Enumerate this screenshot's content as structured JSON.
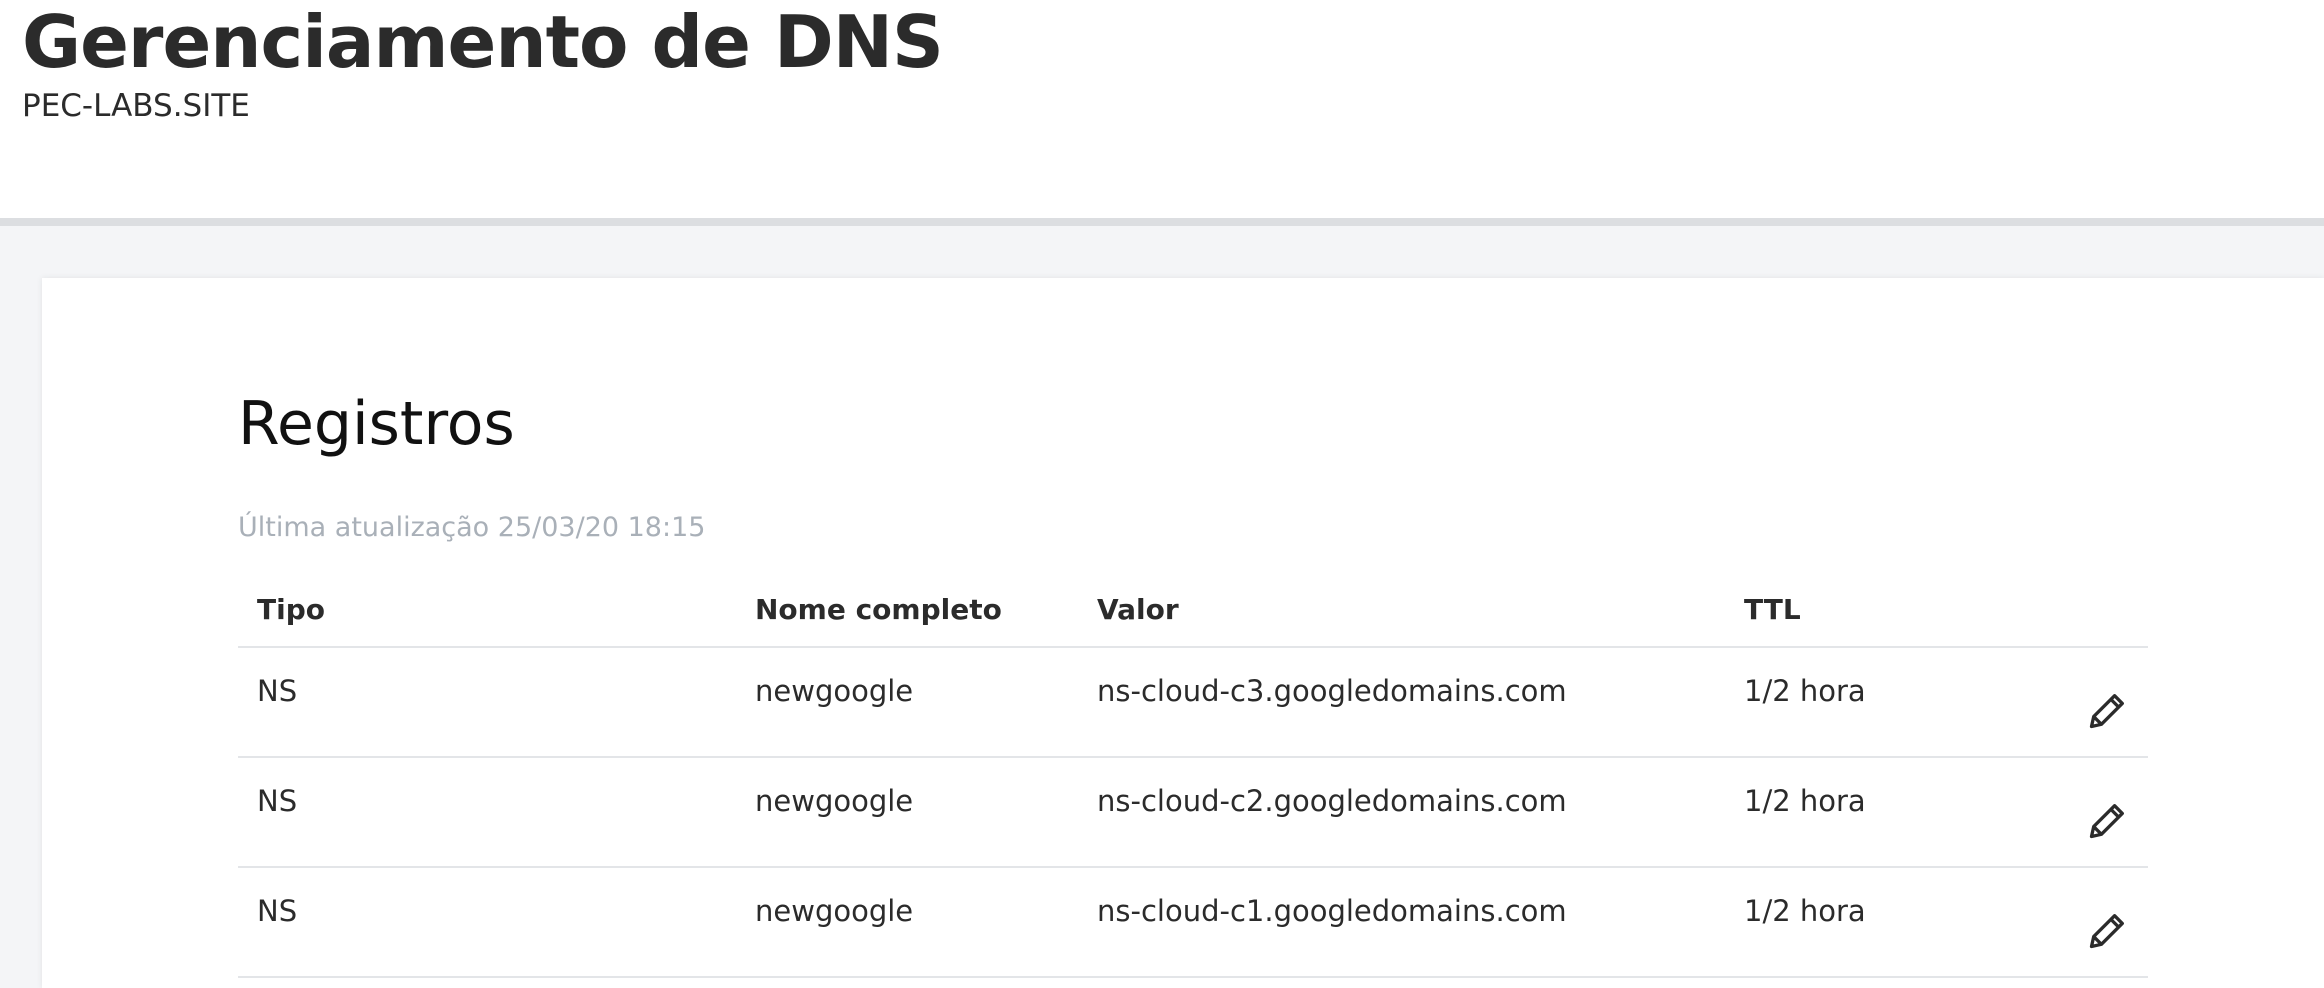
{
  "header": {
    "title": "Gerenciamento de DNS",
    "domain": "PEC-LABS.SITE"
  },
  "records": {
    "title": "Registros",
    "last_updated": "Última atualização 25/03/20 18:15",
    "columns": [
      "Tipo",
      "Nome completo",
      "Valor",
      "TTL"
    ],
    "rows": [
      {
        "tipo": "NS",
        "nome": "newgoogle",
        "valor": "ns-cloud-c3.googledomains.com",
        "ttl": "1/2 hora",
        "action_icon": "pencil-icon"
      },
      {
        "tipo": "NS",
        "nome": "newgoogle",
        "valor": "ns-cloud-c2.googledomains.com",
        "ttl": "1/2 hora",
        "action_icon": "pencil-icon"
      },
      {
        "tipo": "NS",
        "nome": "newgoogle",
        "valor": "ns-cloud-c1.googledomains.com",
        "ttl": "1/2 hora",
        "action_icon": "pencil-icon"
      }
    ]
  },
  "colors": {
    "text": "#2b2b2b",
    "muted": "#a9b0b8",
    "background": "#f4f5f7",
    "divider": "#e3e5e8"
  }
}
